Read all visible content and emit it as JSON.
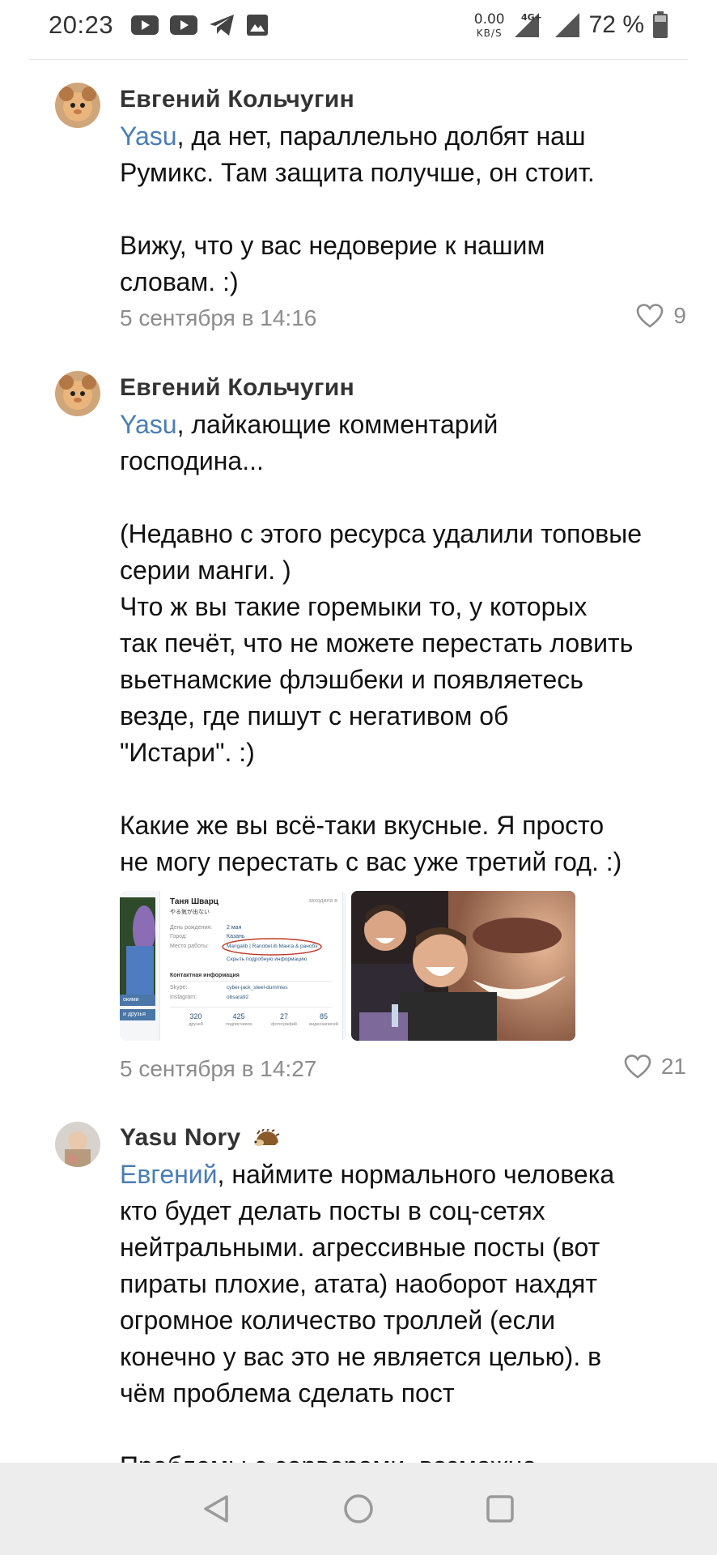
{
  "status_bar": {
    "time": "20:23",
    "net_speed_value": "0.00",
    "net_speed_unit": "KB/S",
    "network_type": "4G+",
    "battery_percent": "72 %",
    "icons": [
      "youtube-icon",
      "youtube-icon",
      "telegram-icon",
      "gallery-icon",
      "signal-icon",
      "signal-icon",
      "battery-icon"
    ]
  },
  "comments": [
    {
      "author": "Евгений Кольчугин",
      "mention": "Yasu",
      "text_after_mention": ", да нет, параллельно долбят наш\nРумикс. Там защита получше, он стоит.\n\nВижу, что у вас недоверие к нашим\nсловам. :)",
      "date": "5 сентября в 14:16",
      "likes": "9"
    },
    {
      "author": "Евгений Кольчугин",
      "mention": "Yasu",
      "text_after_mention": ", лайкающие комментарий\nгосподина...\n\n(Недавно с этого ресурса удалили топовые\nсерии манги. )\nЧто ж вы такие горемыки то, у которых\nтак печёт, что не можете перестать ловить\nвьетнамские флэшбеки и появляетесь\nвезде, где пишут с негативом об\n\"Истари\". :)\n\nКакие же вы всё-таки вкусные. Я просто\nне могу перестать с вас уже третий год. :)",
      "attachment_profile": {
        "name": "Таня Шварц",
        "subtitle": "やる気が出ない",
        "online": "заходила в",
        "rows": [
          {
            "label": "День рождения:",
            "value": "2 мая"
          },
          {
            "label": "Город:",
            "value": "Казань"
          },
          {
            "label": "Место работы:",
            "value": "Mangalib | Ranobel.ib Манга & ранобэ"
          }
        ],
        "more_link": "Скрыть подробную информацию",
        "contacts_header": "Контактная информация",
        "contacts": [
          {
            "label": "Skype:",
            "value": "cyber-jack_steel-dummies"
          },
          {
            "label": "Instagram:",
            "value": "obsara92"
          }
        ],
        "counters": [
          {
            "value": "320",
            "label": "друзей"
          },
          {
            "value": "425",
            "label": "подписчиков"
          },
          {
            "value": "27",
            "label": "фотографий"
          },
          {
            "value": "85",
            "label": "видеозаписей"
          }
        ],
        "side_labels": [
          "окими",
          "и друзья"
        ]
      },
      "date": "5 сентября в 14:27",
      "likes": "21"
    },
    {
      "author": "Yasu Nory",
      "mention": "Евгений",
      "text_after_mention": ", наймите нормального человека\nкто будет делать посты в соц-сетях\nнейтральными. агрессивные посты (вот\nпираты плохие, атата) наоборот нахдят\nогромное количество троллей (если\nконечно у вас это не является целью). в\nчём проблема сделать пост\n\nПроблемы с серверами, возможно"
    }
  ]
}
